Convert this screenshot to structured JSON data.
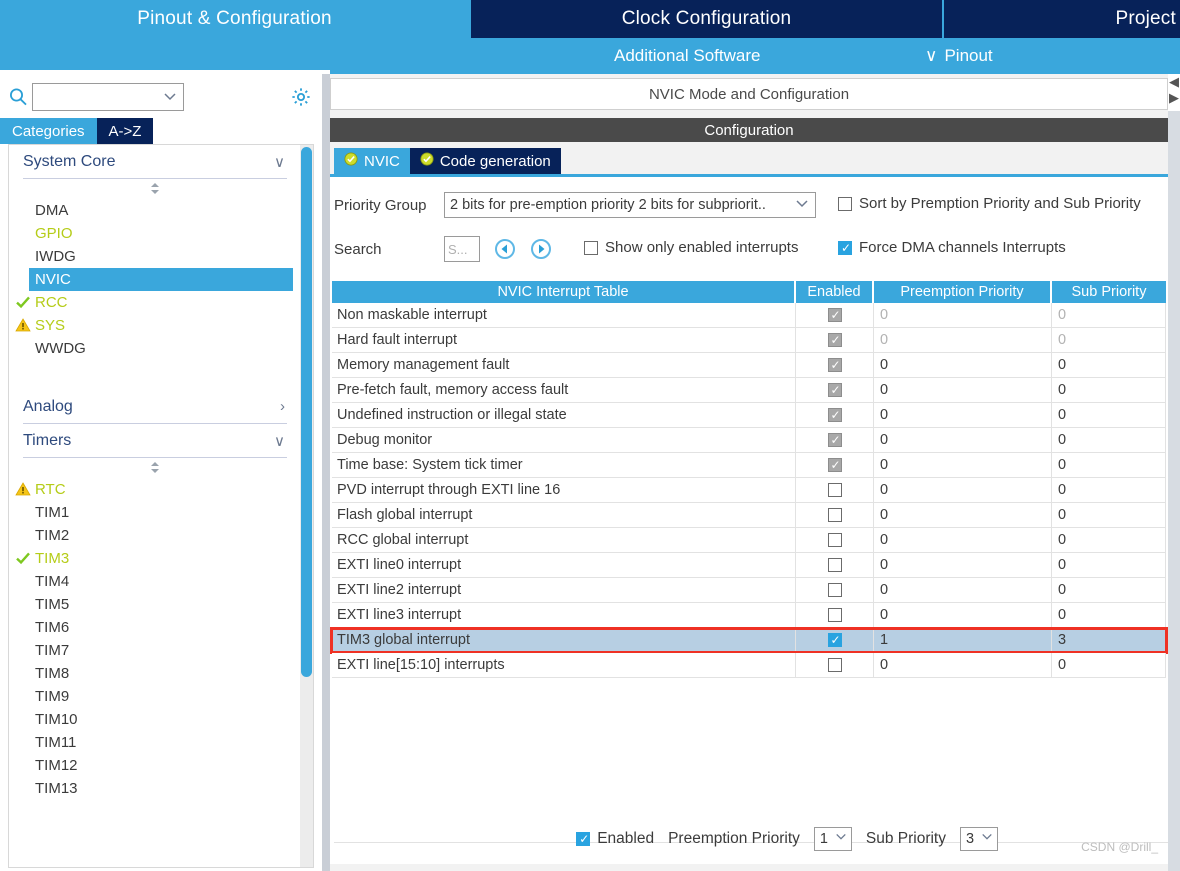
{
  "topbar": {
    "tabs": [
      {
        "label": "Pinout & Configuration",
        "active": true
      },
      {
        "label": "Clock Configuration",
        "active": false
      },
      {
        "label": "Project",
        "active": false
      }
    ]
  },
  "subbar": {
    "additional_software": "Additional Software",
    "pinout": "Pinout",
    "chevron": "∨"
  },
  "sidebar": {
    "search": {
      "value": "",
      "placeholder": ""
    },
    "gear_icon": "gear-icon",
    "search_icon": "search-icon",
    "tabs": [
      {
        "label": "Categories",
        "selected": true
      },
      {
        "label": "A->Z",
        "selected": false
      }
    ],
    "groups": [
      {
        "title": "System Core",
        "expanded": true,
        "arrow": "∨",
        "items": [
          {
            "label": "DMA",
            "state": "none",
            "selected": false
          },
          {
            "label": "GPIO",
            "state": "partial",
            "selected": false
          },
          {
            "label": "IWDG",
            "state": "none",
            "selected": false
          },
          {
            "label": "NVIC",
            "state": "none",
            "selected": true
          },
          {
            "label": "RCC",
            "state": "ok",
            "selected": false
          },
          {
            "label": "SYS",
            "state": "warn",
            "selected": false
          },
          {
            "label": "WWDG",
            "state": "none",
            "selected": false
          }
        ]
      },
      {
        "title": "Analog",
        "expanded": false,
        "arrow": "›",
        "items": []
      },
      {
        "title": "Timers",
        "expanded": true,
        "arrow": "∨",
        "items": [
          {
            "label": "RTC",
            "state": "warn",
            "selected": false
          },
          {
            "label": "TIM1",
            "state": "none",
            "selected": false
          },
          {
            "label": "TIM2",
            "state": "none",
            "selected": false
          },
          {
            "label": "TIM3",
            "state": "ok",
            "selected": false
          },
          {
            "label": "TIM4",
            "state": "none",
            "selected": false
          },
          {
            "label": "TIM5",
            "state": "none",
            "selected": false
          },
          {
            "label": "TIM6",
            "state": "none",
            "selected": false
          },
          {
            "label": "TIM7",
            "state": "none",
            "selected": false
          },
          {
            "label": "TIM8",
            "state": "none",
            "selected": false
          },
          {
            "label": "TIM9",
            "state": "none",
            "selected": false
          },
          {
            "label": "TIM10",
            "state": "none",
            "selected": false
          },
          {
            "label": "TIM11",
            "state": "none",
            "selected": false
          },
          {
            "label": "TIM12",
            "state": "none",
            "selected": false
          },
          {
            "label": "TIM13",
            "state": "none",
            "selected": false
          }
        ]
      }
    ]
  },
  "main": {
    "mode_title": "NVIC Mode and Configuration",
    "configuration_title": "Configuration",
    "tabs": [
      {
        "label": "NVIC",
        "selected": true,
        "icon": "check-circle-icon"
      },
      {
        "label": "Code generation",
        "selected": false,
        "icon": "check-circle-icon"
      }
    ],
    "priority_group": {
      "label": "Priority Group",
      "value": "2 bits for pre-emption priority 2 bits for subpriorit..",
      "chevron": "∨"
    },
    "sort_checkbox": {
      "label": "Sort by Premption Priority and Sub Priority",
      "checked": false
    },
    "search": {
      "label": "Search",
      "value": "",
      "placeholder": "S...",
      "prev_icon": "previous-arrow-icon",
      "next_icon": "next-arrow-icon"
    },
    "show_only_enabled": {
      "label": "Show only enabled interrupts",
      "checked": false
    },
    "force_dma": {
      "label": "Force DMA channels Interrupts",
      "checked": true
    },
    "table": {
      "columns": [
        "NVIC Interrupt Table",
        "Enabled",
        "Preemption Priority",
        "Sub Priority"
      ],
      "rows": [
        {
          "name": "Non maskable interrupt",
          "enabled": true,
          "locked": true,
          "pre": "0",
          "sub": "0",
          "muted": true,
          "selected": false
        },
        {
          "name": "Hard fault interrupt",
          "enabled": true,
          "locked": true,
          "pre": "0",
          "sub": "0",
          "muted": true,
          "selected": false
        },
        {
          "name": "Memory management fault",
          "enabled": true,
          "locked": true,
          "pre": "0",
          "sub": "0",
          "muted": false,
          "selected": false
        },
        {
          "name": "Pre-fetch fault, memory access fault",
          "enabled": true,
          "locked": true,
          "pre": "0",
          "sub": "0",
          "muted": false,
          "selected": false
        },
        {
          "name": "Undefined instruction or illegal state",
          "enabled": true,
          "locked": true,
          "pre": "0",
          "sub": "0",
          "muted": false,
          "selected": false
        },
        {
          "name": "Debug monitor",
          "enabled": true,
          "locked": true,
          "pre": "0",
          "sub": "0",
          "muted": false,
          "selected": false
        },
        {
          "name": "Time base: System tick timer",
          "enabled": true,
          "locked": true,
          "pre": "0",
          "sub": "0",
          "muted": false,
          "selected": false
        },
        {
          "name": "PVD interrupt through EXTI line 16",
          "enabled": false,
          "locked": false,
          "pre": "0",
          "sub": "0",
          "muted": false,
          "selected": false
        },
        {
          "name": "Flash global interrupt",
          "enabled": false,
          "locked": false,
          "pre": "0",
          "sub": "0",
          "muted": false,
          "selected": false
        },
        {
          "name": "RCC global interrupt",
          "enabled": false,
          "locked": false,
          "pre": "0",
          "sub": "0",
          "muted": false,
          "selected": false
        },
        {
          "name": "EXTI line0 interrupt",
          "enabled": false,
          "locked": false,
          "pre": "0",
          "sub": "0",
          "muted": false,
          "selected": false
        },
        {
          "name": "EXTI line2 interrupt",
          "enabled": false,
          "locked": false,
          "pre": "0",
          "sub": "0",
          "muted": false,
          "selected": false
        },
        {
          "name": "EXTI line3 interrupt",
          "enabled": false,
          "locked": false,
          "pre": "0",
          "sub": "0",
          "muted": false,
          "selected": false
        },
        {
          "name": "TIM3 global interrupt",
          "enabled": true,
          "locked": false,
          "pre": "1",
          "sub": "3",
          "muted": false,
          "selected": true
        },
        {
          "name": "EXTI line[15:10] interrupts",
          "enabled": false,
          "locked": false,
          "pre": "0",
          "sub": "0",
          "muted": false,
          "selected": false
        }
      ]
    },
    "footer": {
      "enabled": {
        "label": "Enabled",
        "checked": true
      },
      "preemption": {
        "label": "Preemption Priority",
        "value": "1",
        "chevron": "∨"
      },
      "sub": {
        "label": "Sub Priority",
        "value": "3",
        "chevron": "∨"
      }
    }
  },
  "watermark": "CSDN @Drill_",
  "colors": {
    "accent": "#3aa7dc",
    "dark_navy": "#072259",
    "highlight_red": "#ef3124",
    "row_selected": "#b7cfe3",
    "ok_green": "#b5cc18",
    "warn_yellow": "#f5c518"
  }
}
